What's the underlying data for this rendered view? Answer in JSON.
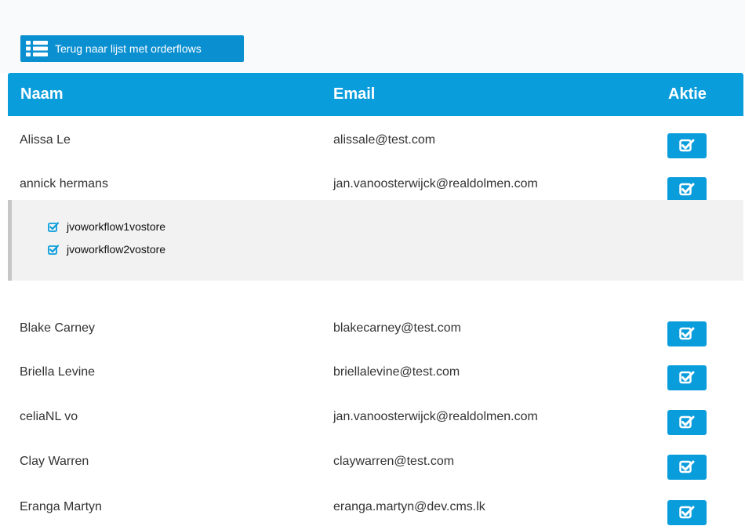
{
  "back_button": {
    "label": "Terug naar lijst met orderflows",
    "icon": "list-icon"
  },
  "table": {
    "headers": {
      "naam": "Naam",
      "email": "Email",
      "aktie": "Aktie"
    },
    "rows": [
      {
        "naam": "Alissa Le",
        "email": "alissale@test.com"
      },
      {
        "naam": "annick hermans",
        "email": "jan.vanoosterwijck@realdolmen.com"
      },
      {
        "naam": "Blake Carney",
        "email": "blakecarney@test.com"
      },
      {
        "naam": "Briella Levine",
        "email": "briellalevine@test.com"
      },
      {
        "naam": "celiaNL vo",
        "email": "jan.vanoosterwijck@realdolmen.com"
      },
      {
        "naam": "Clay Warren",
        "email": "claywarren@test.com"
      },
      {
        "naam": "Eranga Martyn",
        "email": "eranga.martyn@dev.cms.lk"
      }
    ],
    "expanded_workflows": [
      "jvoworkflow1vostore",
      "jvoworkflow2vostore"
    ]
  },
  "colors": {
    "accent": "#0a9ddc",
    "button": "#0a8fd1",
    "detail_bg": "#f2f2f2"
  }
}
